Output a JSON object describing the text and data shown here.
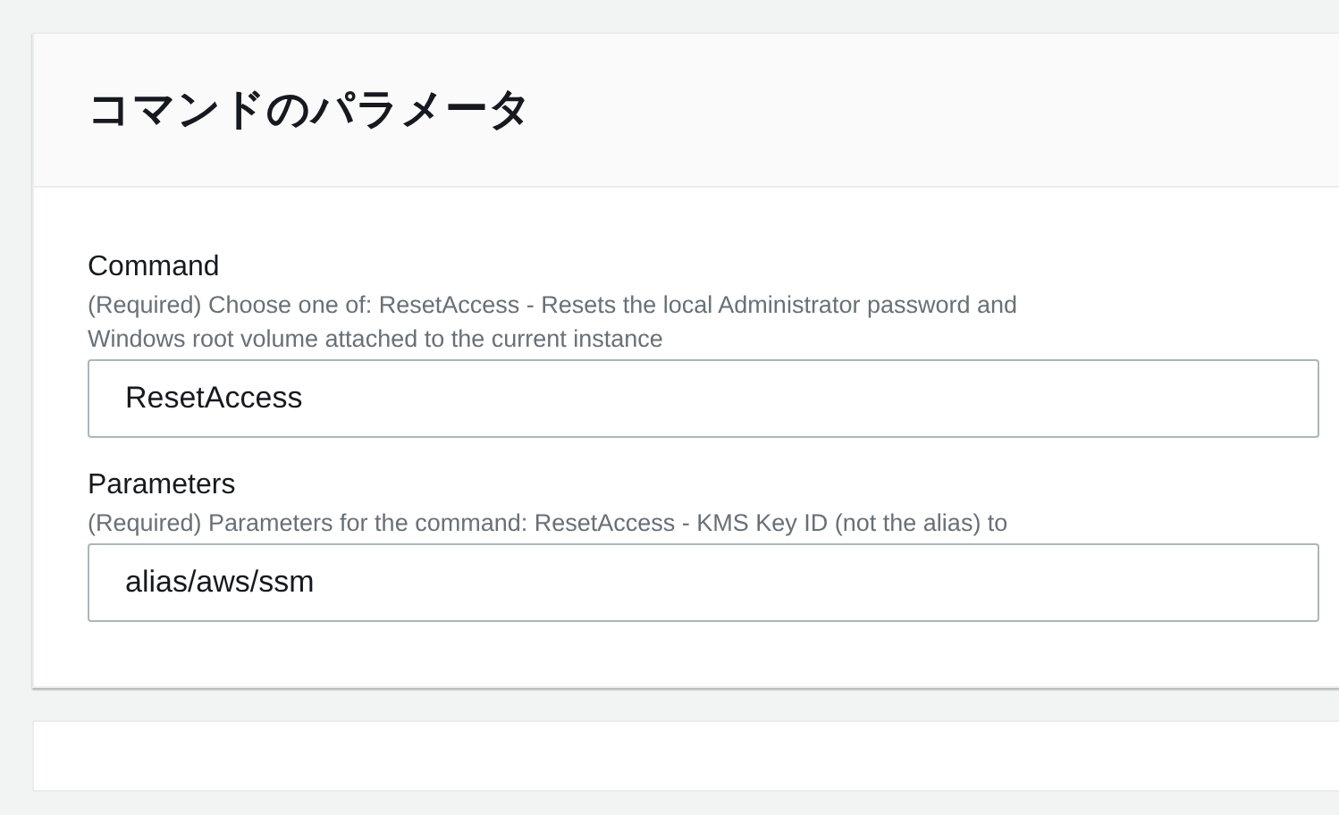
{
  "panel": {
    "title": "コマンドのパラメータ",
    "fields": [
      {
        "label": "Command",
        "description": "(Required) Choose one of: ResetAccess - Resets the local Administrator password and\nWindows root volume attached to the current instance",
        "value": "ResetAccess"
      },
      {
        "label": "Parameters",
        "description": "(Required) Parameters for the command: ResetAccess - KMS Key ID (not the alias) to",
        "value": "alias/aws/ssm"
      }
    ]
  }
}
